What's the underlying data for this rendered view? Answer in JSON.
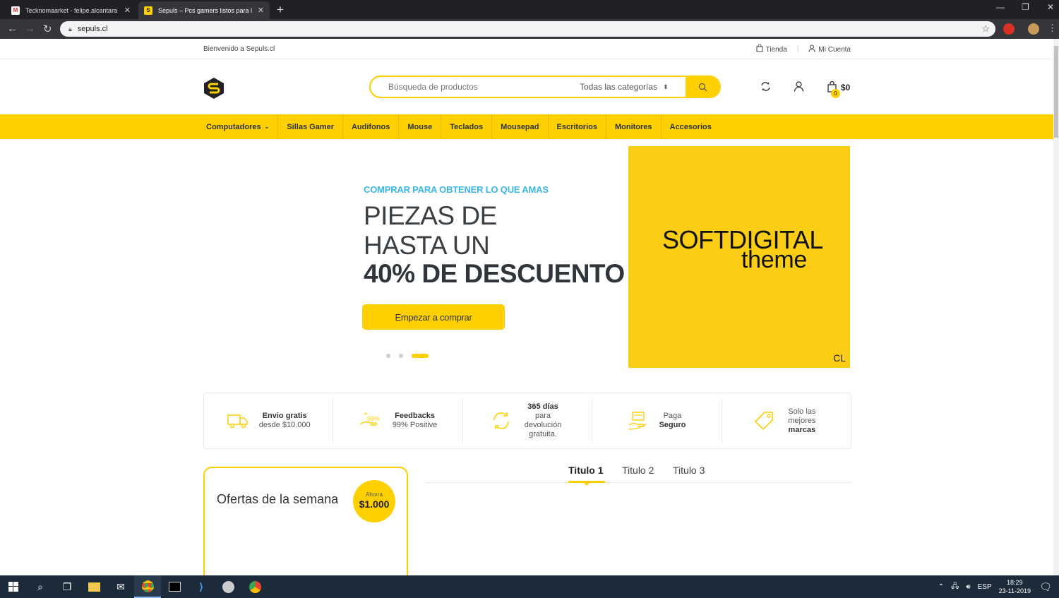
{
  "browser": {
    "tabs": [
      {
        "title": "Tecknomaarket - felipe.alcantara",
        "active": false
      },
      {
        "title": "Sepuls – Pcs gamers listos para l",
        "active": true
      }
    ],
    "url": "sepuls.cl"
  },
  "topbar": {
    "welcome": "Bienvenido a Sepuls.cl",
    "shop_label": "Tienda",
    "account_label": "Mi Cuenta"
  },
  "header": {
    "search_placeholder": "Búsqueda de productos",
    "category_label": "Todas las categorías",
    "cart_total": "$0",
    "cart_count": "0"
  },
  "menu": [
    {
      "label": "Computadores",
      "has_dropdown": true
    },
    {
      "label": "Sillas Gamer"
    },
    {
      "label": "Audifonos"
    },
    {
      "label": "Mouse"
    },
    {
      "label": "Teclados"
    },
    {
      "label": "Mousepad"
    },
    {
      "label": "Escritorios"
    },
    {
      "label": "Monitores"
    },
    {
      "label": "Accesorios"
    }
  ],
  "hero": {
    "eyebrow": "COMPRAR PARA OBTENER LO QUE AMAS",
    "line1": "PIEZAS DE",
    "line2": "HASTA UN",
    "line3": "40% DE DESCUENTO",
    "cta": "Empezar a comprar",
    "slide_active": 3,
    "slide_count": 3
  },
  "banner": {
    "line1": "SOFTDIGITAL",
    "line2": "theme",
    "corner": "CL"
  },
  "features": [
    {
      "bold": "Envio gratis",
      "text": "desde $10.000"
    },
    {
      "bold": "Feedbacks",
      "text": "99% Positive"
    },
    {
      "bold": "365 días",
      "text": "para devolución gratuita."
    },
    {
      "text": "Paga",
      "bold": "Seguro"
    },
    {
      "text": "Solo las mejores",
      "bold": "marcas"
    }
  ],
  "offers": {
    "title": "Ofertas de la semana",
    "save_label": "Ahorra",
    "save_value": "$1.000"
  },
  "tabs": [
    "Titulo 1",
    "Titulo 2",
    "Titulo 3"
  ],
  "taskbar": {
    "lang": "ESP",
    "time": "18:29",
    "date": "23-11-2019"
  },
  "colors": {
    "accent": "#ffd000",
    "eyebrow": "#3ab7e6"
  }
}
